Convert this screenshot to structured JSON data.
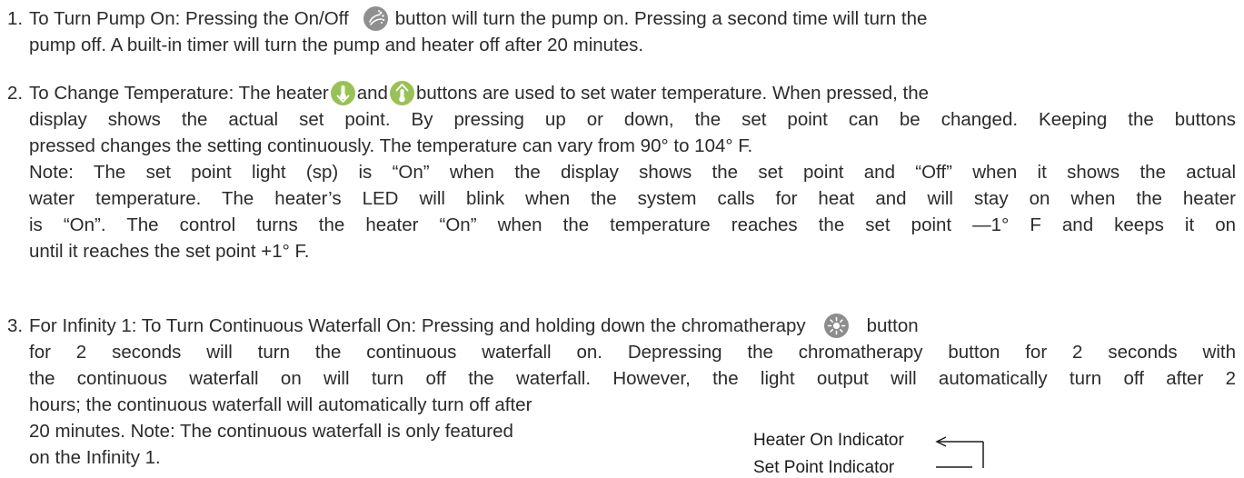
{
  "items": [
    {
      "number": "1.",
      "lines": [
        "To Turn Pump On: Pressing the On/Off",
        "button will turn the pump on. Pressing a second time will turn the",
        "pump off. A built-in timer will turn the pump and heater off after 20 minutes."
      ]
    },
    {
      "number": "2.",
      "lines": [
        "To Change Temperature: The heater",
        "and",
        "buttons are used to set water temperature. When pressed, the",
        "display shows the actual set point. By pressing up or down, the set point can be changed. Keeping the buttons",
        "pressed changes the setting continuously. The temperature can vary from 90° to 104° F.",
        "Note: The set point light (sp) is “On” when the display shows the set point and “Off” when it shows the actual",
        "water temperature. The heater’s LED will blink when the system calls for heat and will stay on when the heater",
        "is “On”. The control turns the heater “On” when the temperature reaches the set point —1° F and keeps it on",
        "until it reaches the set point +1° F."
      ]
    },
    {
      "number": "3.",
      "lines": [
        "For Infinity 1: To Turn Continuous Waterfall On: Pressing and holding down the chromatherapy",
        "button",
        "for 2 seconds will turn the continuous waterfall on. Depressing the chromatherapy button for 2 seconds with",
        "the continuous waterfall on will turn off the waterfall. However, the light output will automatically turn off after 2",
        "hours; the continuous waterfall will automatically turn off after",
        "20 minutes. Note: The continuous waterfall is only featured",
        "on the Infinity 1."
      ]
    }
  ],
  "labels": {
    "heater_on": "Heater On Indicator",
    "set_point": "Set Point Indicator"
  },
  "icons": {
    "pump": "pump-jets-icon",
    "temp_down": "temperature-down-icon",
    "temp_up": "temperature-up-icon",
    "chroma": "chromatherapy-light-icon"
  },
  "colors": {
    "text": "#2b2b2b",
    "pump_icon": "#8f8f8f",
    "temp_icon": "#98c255",
    "chroma_icon": "#8d8d8d"
  }
}
